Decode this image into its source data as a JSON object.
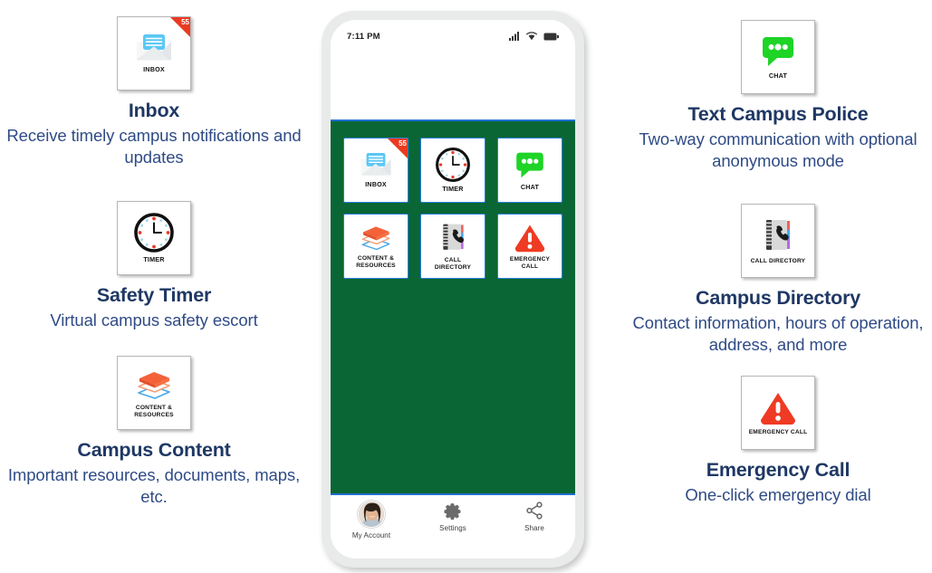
{
  "features_left": [
    {
      "icon": "inbox-icon",
      "tile_label": "INBOX",
      "badge": "55",
      "title": "Inbox",
      "desc": "Receive timely campus notifications and updates"
    },
    {
      "icon": "timer-icon",
      "tile_label": "TIMER",
      "title": "Safety Timer",
      "desc": "Virtual campus safety escort"
    },
    {
      "icon": "content-resources-icon",
      "tile_label": "CONTENT & RESOURCES",
      "title": "Campus Content",
      "desc": "Important resources, documents, maps, etc."
    }
  ],
  "features_right": [
    {
      "icon": "chat-icon",
      "tile_label": "CHAT",
      "title": "Text Campus Police",
      "desc": "Two-way communication with optional anonymous mode"
    },
    {
      "icon": "call-directory-icon",
      "tile_label": "CALL DIRECTORY",
      "title": "Campus Directory",
      "desc": "Contact information, hours of operation, address, and more"
    },
    {
      "icon": "emergency-call-icon",
      "tile_label": "EMERGENCY CALL",
      "title": "Emergency Call",
      "desc": "One-click emergency dial"
    }
  ],
  "phone": {
    "statusbar": {
      "time": "7:11 PM",
      "icons": [
        "signal-icon",
        "wifi-icon",
        "battery-icon"
      ]
    },
    "app_grid": [
      {
        "icon": "inbox-icon",
        "label": "INBOX",
        "badge": "55"
      },
      {
        "icon": "timer-icon",
        "label": "TIMER"
      },
      {
        "icon": "chat-icon",
        "label": "CHAT"
      },
      {
        "icon": "content-resources-icon",
        "label_line1": "CONTENT &",
        "label_line2": "RESOURCES"
      },
      {
        "icon": "call-directory-icon",
        "label_line1": "CALL",
        "label_line2": "DIRECTORY"
      },
      {
        "icon": "emergency-call-icon",
        "label_line1": "EMERGENCY",
        "label_line2": "CALL"
      }
    ],
    "bottom_nav": [
      {
        "icon": "avatar-icon",
        "label": "My Account"
      },
      {
        "icon": "gear-icon",
        "label": "Settings"
      },
      {
        "icon": "share-icon",
        "label": "Share"
      }
    ]
  },
  "colors": {
    "app_green": "#0a6634",
    "tile_border_blue": "#2a7fe0",
    "heading_navy": "#1f3864",
    "body_navy": "#2f4b86",
    "badge_red": "#eb3a21",
    "chat_green": "#1ed427",
    "emergency_red": "#ef3b23",
    "book_orange": "#f4623a",
    "book_blue": "#49a9e8",
    "envelope_blue": "#5bc8f5"
  }
}
